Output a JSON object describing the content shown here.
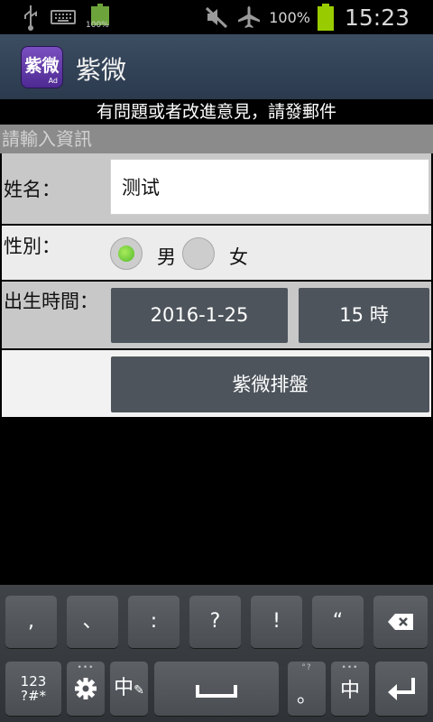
{
  "status_bar": {
    "battery_percent": "100%",
    "time": "15:23",
    "small_battery_label": "100%",
    "icons": [
      "usb-icon",
      "keyboard-icon",
      "battery-charging-icon",
      "mute-icon",
      "airplane-mode-icon",
      "battery-icon"
    ]
  },
  "app": {
    "icon_text": "紫微",
    "icon_sub": "Ad",
    "title": "紫微"
  },
  "notice": "有問題或者改進意見，請發郵件",
  "section_header": "請輸入資訊",
  "form": {
    "name_label": "姓名：",
    "name_value": "测试",
    "gender_label": "性別：",
    "gender_options": [
      "男",
      "女"
    ],
    "gender_selected": "男",
    "birth_label": "出生時間：",
    "birth_date": "2016-1-25",
    "birth_hour": "15 時",
    "submit_label": "紫微排盤"
  },
  "keyboard": {
    "row1": [
      ",",
      "、",
      ":",
      "?",
      "!",
      "“"
    ],
    "backspace_icon": "backspace-icon",
    "mode_label_1": "123",
    "mode_label_2": "?#*",
    "settings_icon": "gear-icon",
    "handwriting_label": "中",
    "space_icon": "space-icon",
    "dot_label": "。",
    "dot_hint": "°?",
    "lang_label": "中",
    "enter_icon": "enter-icon"
  },
  "colors": {
    "actionbar": "#34455a",
    "section_header": "#8b8b8b",
    "button_dark": "#4d545c",
    "radio_selected": "#6fd23a"
  }
}
